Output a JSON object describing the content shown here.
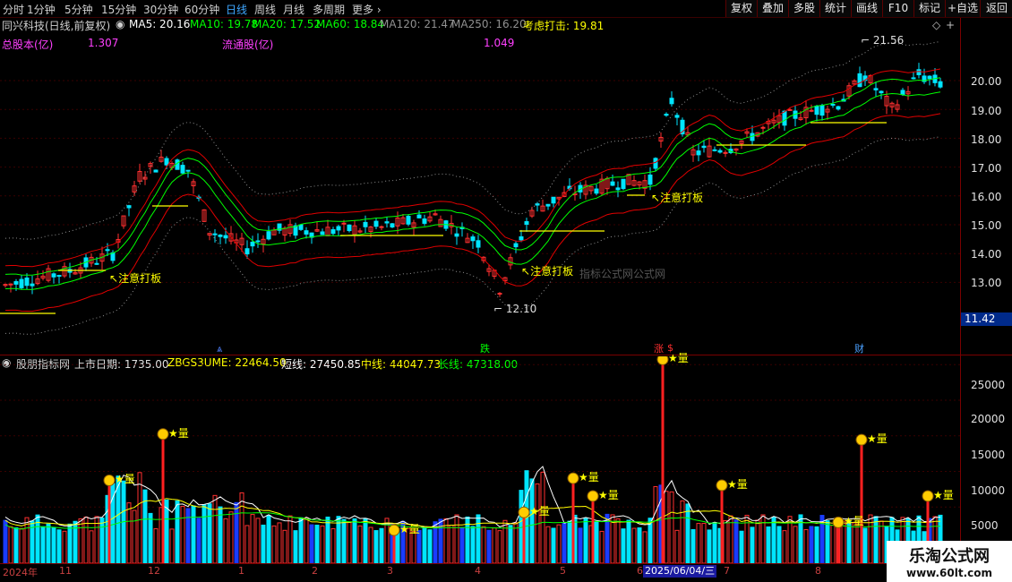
{
  "toolbar": {
    "periods": [
      "分时",
      "1分钟",
      "5分钟",
      "15分钟",
      "30分钟",
      "60分钟",
      "日线",
      "周线",
      "月线",
      "多周期",
      "更多"
    ],
    "active_period": "日线",
    "right_buttons": [
      "复权",
      "叠加",
      "多股",
      "统计",
      "画线",
      "F10",
      "标记",
      "+自选",
      "返回"
    ]
  },
  "stock": {
    "title": "同兴科技(日线,前复权)",
    "ma": [
      {
        "label": "MA5: 20.16",
        "color": "#ffffff"
      },
      {
        "label": "MA10: 19.78",
        "color": "#00ff00"
      },
      {
        "label": "MA20: 17.52",
        "color": "#00ff00"
      },
      {
        "label": "MA60: 18.84",
        "color": "#00ff00"
      },
      {
        "label": "MA120: 21.47",
        "color": "#909090"
      },
      {
        "label": "MA250: 16.20",
        "color": "#909090"
      }
    ],
    "consider": "考虑打击: 19.81",
    "total_share_label": "总股本(亿)",
    "total_share_value": "1.307",
    "float_share_label": "流通股(亿)",
    "float_share_value": "1.049"
  },
  "price_axis": {
    "ticks": [
      "20.00",
      "19.00",
      "18.00",
      "17.00",
      "16.00",
      "15.00",
      "14.00",
      "13.00"
    ],
    "current": "11.42"
  },
  "annotations": {
    "high": "21.56",
    "low": "12.10",
    "alerts": [
      "注意打板",
      "注意打板",
      "注意打板"
    ],
    "watermark": "指标公式网公式网"
  },
  "event_marks": {
    "down": "跌",
    "up": "涨",
    "finance": "财"
  },
  "indicator": {
    "name": "股朋指标网",
    "listing_label": "上市日期: 1735.00",
    "zbgs": "ZBGS3UME: 22464.50",
    "short": "短线: 27450.85",
    "mid": "中线: 44047.73",
    "long": "长线: 47318.00",
    "ticks": [
      "25000",
      "20000",
      "15000",
      "10000",
      "5000"
    ],
    "star_label": "★量"
  },
  "date_axis": {
    "labels": [
      "2024年",
      "11",
      "12",
      "1",
      "2",
      "3",
      "4",
      "5",
      "6",
      "7",
      "8"
    ],
    "cursor_date": "2025/06/04/三"
  },
  "brand": {
    "name": "乐淘公式网",
    "url": "www.60lt.com"
  },
  "colors": {
    "up": "#ff3030",
    "down": "#00e5ff",
    "ma_green": "#00ff00",
    "boll_red": "#e00000",
    "yellow": "#ffff00"
  }
}
